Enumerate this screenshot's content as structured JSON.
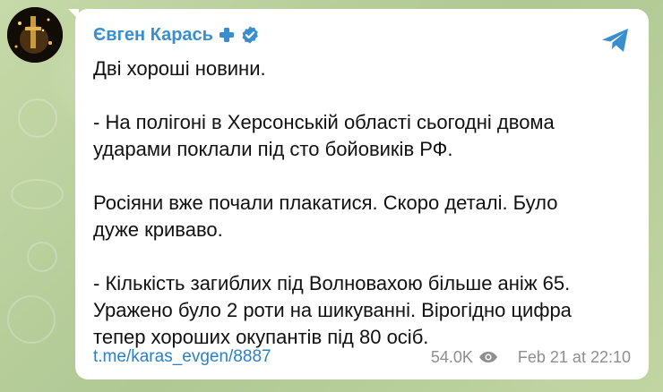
{
  "post": {
    "sender_name": "Євген Карась",
    "message_paragraphs": [
      "Дві хороші новини.",
      "- На полігоні в Херсонській області сьогодні двома\nударами поклали під сто бойовиків РФ.",
      "Росіяни вже почали плакатися. Скоро деталі. Було\nдуже криваво.",
      "- Кількість загиблих під Волновахою більше аніж 65.\nУражено було 2 роти на шикуванні. Вірогідно цифра\nтепер хороших окупантів під 80 осіб."
    ],
    "link_text": "t.me/karas_evgen/8887",
    "views": "54.0K",
    "timestamp": "Feb 21 at 22:10"
  },
  "icons": {
    "cross": "cross-icon",
    "verified": "verified-badge-icon",
    "share": "telegram-share-icon",
    "views": "eye-icon"
  },
  "colors": {
    "sender": "#3a8ed0",
    "link": "#2a7fc8",
    "verified": "#3a8ed0",
    "share": "#3a8ed0",
    "meta": "#8e8e8e"
  }
}
